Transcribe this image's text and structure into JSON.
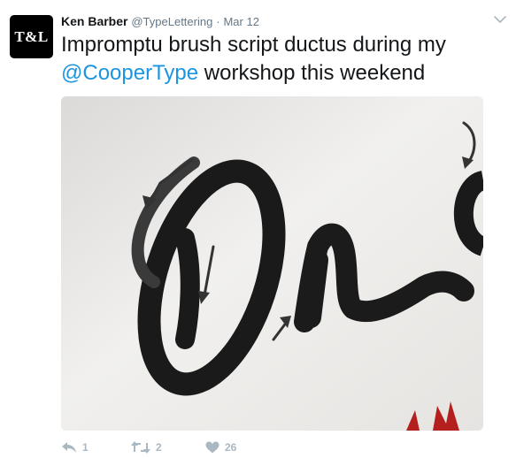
{
  "tweet": {
    "author_name": "Ken Barber",
    "author_handle": "@TypeLettering",
    "separator": "·",
    "date": "Mar 12",
    "avatar_text": "T&L",
    "text_before": "Impromptu brush script ductus during my ",
    "mention": "@CooperType",
    "text_after": " workshop this weekend",
    "photo_icon": "brush-lettering-photo"
  },
  "actions": {
    "reply_count": "1",
    "retweet_count": "2",
    "like_count": "26",
    "reply_icon": "reply-icon",
    "retweet_icon": "retweet-icon",
    "like_icon": "heart-icon"
  },
  "colors": {
    "link": "#1b95e0",
    "muted": "#657786",
    "action_gray": "#aab8c2"
  }
}
